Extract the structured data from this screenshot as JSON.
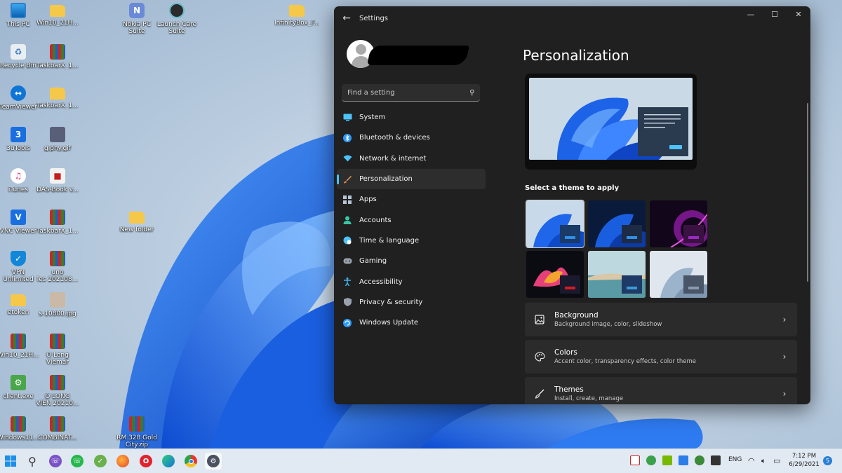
{
  "desktop": {
    "icons": [
      {
        "label": "This PC"
      },
      {
        "label": "Win10_21H..."
      },
      {
        "label": "Nokia PC\nSuite"
      },
      {
        "label": "Launch Care\nSuite"
      },
      {
        "label": "InfinityBox_F..."
      },
      {
        "label": "Recycle Bin"
      },
      {
        "label": "TaskbarX_1..."
      },
      {
        "label": "TeamViewer"
      },
      {
        "label": "TaskbarX_1..."
      },
      {
        "label": "3uTools"
      },
      {
        "label": "giphy.gif"
      },
      {
        "label": "iTunes"
      },
      {
        "label": "DAS-Book v..."
      },
      {
        "label": "VNC Viewer"
      },
      {
        "label": "TaskbarX_1..."
      },
      {
        "label": "New folder"
      },
      {
        "label": "VPN\nUnlimited"
      },
      {
        "label": "uno\nles 202108..."
      },
      {
        "label": "etoken"
      },
      {
        "label": "s-10800.jpg"
      },
      {
        "label": "Win10_21H..."
      },
      {
        "label": "Ô Long\nViemar"
      },
      {
        "label": "client.exe"
      },
      {
        "label": "Ô LONG\nVIÊN 20210..."
      },
      {
        "label": "Windows11..."
      },
      {
        "label": "COMBINAT..."
      },
      {
        "label": "RM 328 Gold\nCity.zip"
      }
    ]
  },
  "settings": {
    "window_title": "Settings",
    "search_placeholder": "Find a setting",
    "nav": [
      {
        "label": "System",
        "icon": "monitor-icon",
        "color": "#4cc2ff"
      },
      {
        "label": "Bluetooth & devices",
        "icon": "bluetooth-icon",
        "color": "#2f9bff"
      },
      {
        "label": "Network & internet",
        "icon": "wifi-icon",
        "color": "#4cc2ff"
      },
      {
        "label": "Personalization",
        "icon": "paintbrush-icon",
        "color": "#e38b4d",
        "active": true
      },
      {
        "label": "Apps",
        "icon": "apps-icon",
        "color": "#b7c5d8"
      },
      {
        "label": "Accounts",
        "icon": "person-icon",
        "color": "#38c7a5"
      },
      {
        "label": "Time & language",
        "icon": "globe-icon",
        "color": "#4cc2ff"
      },
      {
        "label": "Gaming",
        "icon": "gamepad-icon",
        "color": "#9aa3ad"
      },
      {
        "label": "Accessibility",
        "icon": "accessibility-icon",
        "color": "#3fb4f0"
      },
      {
        "label": "Privacy & security",
        "icon": "shield-icon",
        "color": "#9aa3ad"
      },
      {
        "label": "Windows Update",
        "icon": "update-icon",
        "color": "#2f9bff"
      }
    ],
    "page_title": "Personalization",
    "theme_heading": "Select a theme to apply",
    "themes": [
      {
        "name": "windows-light",
        "accent": "#1c6fd1"
      },
      {
        "name": "windows-dark",
        "accent": "#1c6fd1"
      },
      {
        "name": "glow",
        "accent": "#8a1ab0"
      },
      {
        "name": "captured-motion",
        "accent": "#c4141d"
      },
      {
        "name": "flow",
        "accent": "#2a8ec9"
      },
      {
        "name": "sunrise",
        "accent": "#7a8aa0"
      }
    ],
    "cards": [
      {
        "title": "Background",
        "subtitle": "Background image, color, slideshow",
        "icon": "image-icon"
      },
      {
        "title": "Colors",
        "subtitle": "Accent color, transparency effects, color theme",
        "icon": "palette-icon"
      },
      {
        "title": "Themes",
        "subtitle": "Install, create, manage",
        "icon": "brush-icon"
      }
    ]
  },
  "taskbar": {
    "language": "ENG",
    "time": "7:12 PM",
    "date": "6/29/2021",
    "notifications": "5"
  }
}
